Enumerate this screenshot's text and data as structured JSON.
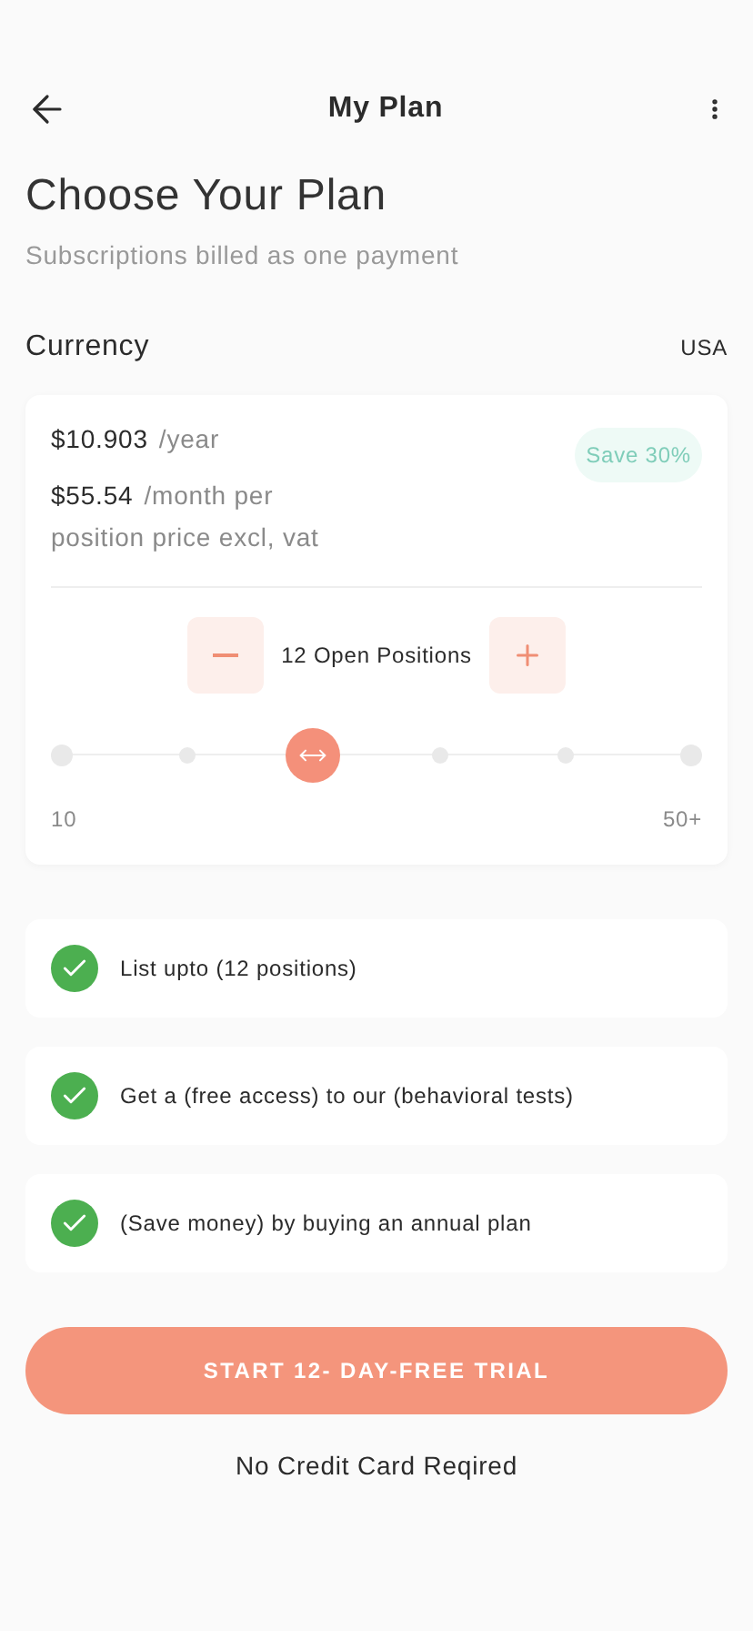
{
  "header": {
    "title": "My Plan"
  },
  "heading": "Choose Your Plan",
  "subheading": "Subscriptions billed as one payment",
  "currency": {
    "label": "Currency",
    "value": "USA"
  },
  "plan": {
    "yearly_price": "$10.903",
    "yearly_unit": "/year",
    "monthly_price": "$55.54",
    "monthly_unit": "/month per",
    "note": "position price excl, vat",
    "badge": "Save 30%",
    "positions": "12 Open Positions",
    "slider": {
      "level": 0.4,
      "min_label": "10",
      "max_label": "50+"
    }
  },
  "features": [
    {
      "text": "List upto (12 positions)",
      "checked": true
    },
    {
      "text": "Get a (free access) to our (behavioral tests)",
      "checked": true
    },
    {
      "text": "(Save money) by buying an annual plan",
      "checked": true
    }
  ],
  "cta": "START 12- DAY-FREE TRIAL",
  "footnote": "No Credit Card Reqired"
}
